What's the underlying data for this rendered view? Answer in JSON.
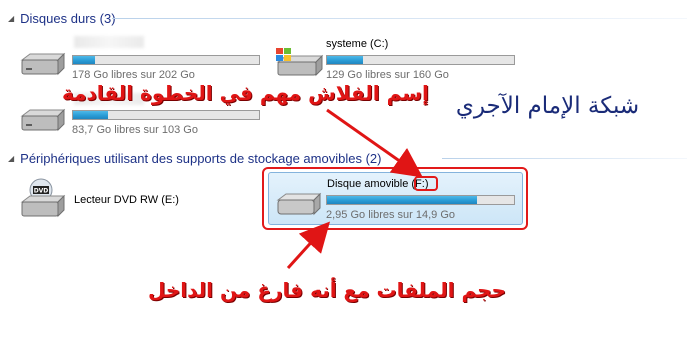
{
  "groups": {
    "hard_disks": {
      "label": "Disques durs (3)"
    },
    "removable": {
      "label": "Périphériques utilisant des supports de stockage amovibles (2)"
    }
  },
  "drives": {
    "unnamed_1": {
      "name": "",
      "info": "178 Go libres sur 202 Go",
      "used_fraction": 0.12
    },
    "system_c": {
      "name": "systeme (C:)",
      "info": "129 Go libres sur 160 Go",
      "used_fraction": 0.19
    },
    "unnamed_2": {
      "name": "",
      "info": "83,7 Go libres sur 103 Go",
      "used_fraction": 0.19
    },
    "dvd_e": {
      "name": "Lecteur DVD RW (E:)"
    },
    "removable_f": {
      "name": "Disque amovible (F:)",
      "info": "2,95 Go libres sur 14,9 Go",
      "used_fraction": 0.8
    }
  },
  "annotations": {
    "top": "إسم الفلاش مهم في الخطوة القادمة",
    "bottom": "حجم الملفات مع أنه فارغ من الداخل",
    "watermark": "شبكة الإمام الآجري"
  },
  "colors": {
    "group_header": "#1e3287",
    "progress": "#2a9cd6",
    "annotation": "#e01515",
    "watermark": "#1a2b78"
  },
  "icons": {
    "hdd": "hard-drive-icon",
    "windows_hdd": "windows-drive-icon",
    "dvd": "dvd-drive-icon",
    "usb": "removable-drive-icon"
  }
}
